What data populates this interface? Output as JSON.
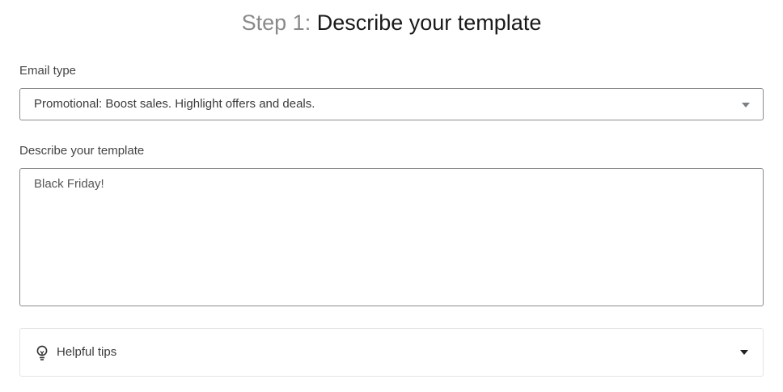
{
  "heading": {
    "step": "Step 1:",
    "title": "Describe your template"
  },
  "email_type": {
    "label": "Email type",
    "selected": "Promotional: Boost sales. Highlight offers and deals.",
    "caret_icon": "chevron-down-icon"
  },
  "description": {
    "label": "Describe your template",
    "value": "Black Friday!"
  },
  "tips": {
    "label": "Helpful tips",
    "icon": "lightbulb-icon",
    "caret_icon": "chevron-down-icon"
  },
  "colors": {
    "step_gray": "#8a8a8a",
    "title_dark": "#1a1a1a",
    "border": "#8c8c8c"
  }
}
